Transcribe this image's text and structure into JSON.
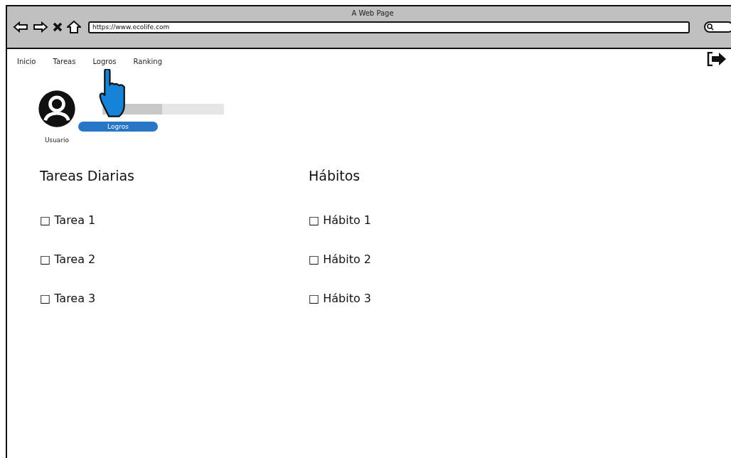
{
  "window": {
    "title": "A Web Page",
    "url": "https://www.ecolife.com"
  },
  "nav": [
    {
      "label": "Inicio"
    },
    {
      "label": "Tareas"
    },
    {
      "label": "Logros"
    },
    {
      "label": "Ranking"
    }
  ],
  "profile": {
    "name": "Usuario",
    "progress": {
      "level": 0.49
    },
    "button": "Logros"
  },
  "sections": [
    {
      "title": "Tareas Diarias",
      "items": [
        "□ Tarea 1",
        "□ Tarea 2",
        "□ Tarea 3"
      ]
    },
    {
      "title": "Hábitos",
      "items": [
        "□ Hábito 1",
        "□ Hábito 2",
        "□ Hábito 3"
      ]
    }
  ]
}
